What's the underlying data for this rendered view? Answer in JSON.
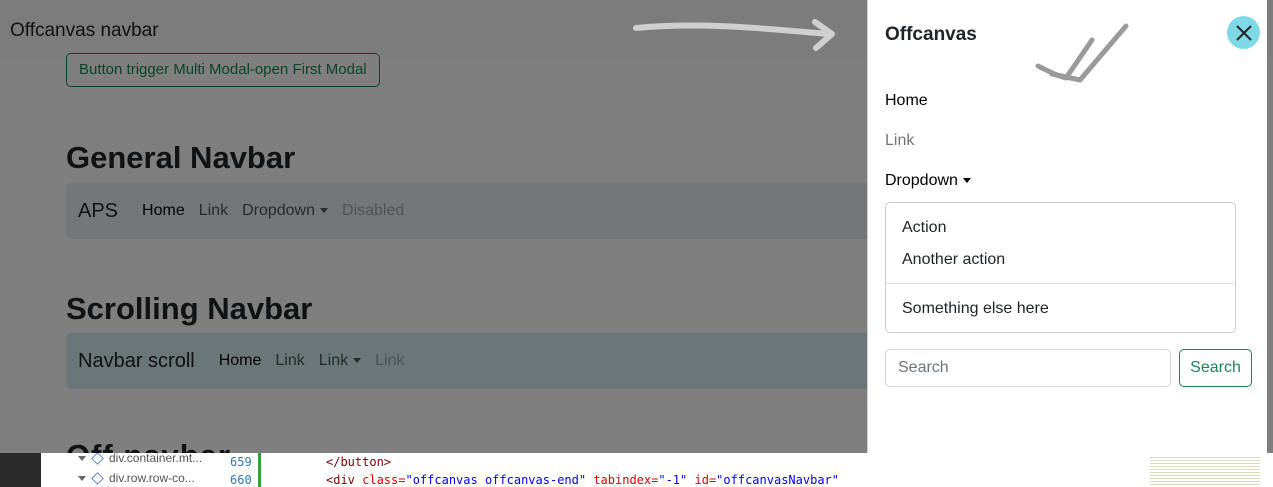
{
  "page": {
    "topbar_brand": "Offcanvas navbar",
    "modal_button_label": "Button trigger Multi Modal-open First Modal",
    "general_title": "General Navbar",
    "general_navbar": {
      "brand": "APS",
      "links": [
        "Home",
        "Link",
        "Dropdown",
        "Disabled"
      ]
    },
    "scrolling_title": "Scrolling Navbar",
    "scrolling_navbar": {
      "brand": "Navbar scroll",
      "links": [
        "Home",
        "Link",
        "Link",
        "Link"
      ]
    },
    "peek_title": "Off            navbar"
  },
  "offcanvas": {
    "title": "Offcanvas",
    "links": {
      "home": "Home",
      "link": "Link",
      "dropdown": "Dropdown"
    },
    "dropdown_items": [
      "Action",
      "Another action",
      "Something else here"
    ],
    "search": {
      "placeholder": "Search",
      "button_label": "Search"
    }
  },
  "devtools": {
    "tree": [
      "div.container.mt...",
      "div.row.row-co..."
    ],
    "line_numbers": [
      "659",
      "660"
    ],
    "code_line_1": "</button>",
    "code_line_2": {
      "open": "<div",
      "attr1": " class=",
      "val1": "\"offcanvas offcanvas-end\"",
      "attr2": " tabindex=",
      "val2": "\"-1\"",
      "attr3": " id=",
      "val3": "\"offcanvasNavbar\""
    }
  },
  "colors": {
    "success": "#198754",
    "close_button": "#7fd8e6",
    "scroll_navbar_bg": "#d4edf1",
    "general_navbar_bg": "#e9ecef"
  },
  "icons": [
    "close-icon",
    "caret-down-icon",
    "arrow-annotation",
    "check-annotation"
  ]
}
